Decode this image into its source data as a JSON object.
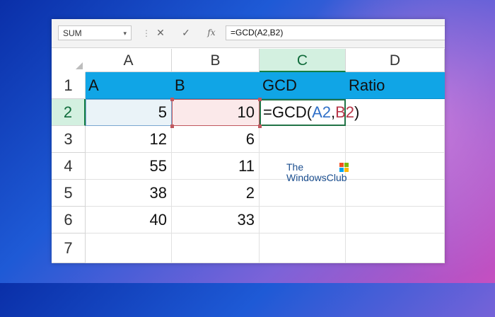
{
  "formula_bar": {
    "name_box": "SUM",
    "cancel_icon": "✕",
    "enter_icon": "✓",
    "fx_label": "fx",
    "formula": "=GCD(A2,B2)"
  },
  "columns": [
    "A",
    "B",
    "C",
    "D"
  ],
  "rows": [
    "1",
    "2",
    "3",
    "4",
    "5",
    "6",
    "7"
  ],
  "header_row": {
    "a": "A",
    "b": "B",
    "c": "GCD",
    "d": "Ratio"
  },
  "data_rows": [
    {
      "a": "5",
      "b": "10"
    },
    {
      "a": "12",
      "b": "6"
    },
    {
      "a": "55",
      "b": "11"
    },
    {
      "a": "38",
      "b": "2"
    },
    {
      "a": "40",
      "b": "33"
    }
  ],
  "active_cell_formula": {
    "prefix": "=GCD(",
    "ref_a": "A2",
    "comma": ",",
    "ref_b": "B2",
    "suffix": ")"
  },
  "watermark": {
    "line1": "The",
    "line2": "WindowsClub"
  },
  "colors": {
    "header_fill": "#10a5e6",
    "active_green": "#217346",
    "ref_a_color": "#3070c8",
    "ref_b_color": "#b8384a"
  }
}
